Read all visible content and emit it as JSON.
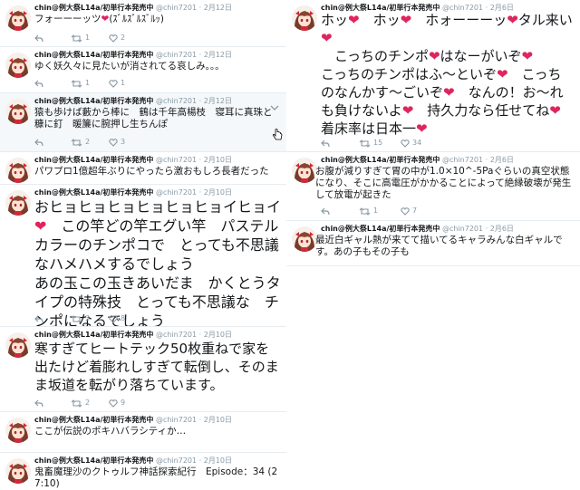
{
  "user": {
    "name": "chin@例大祭L14a/初単行本発売中",
    "handle": "@chin7201",
    "separator": "·"
  },
  "left_tweets": [
    {
      "date": "2月12日",
      "text": "フォーーーッツ❤️(ｽﾞﾙｽﾞﾙｽﾞﾙｯ)",
      "reply_count": "",
      "retweet_count": "1",
      "like_count": "2"
    },
    {
      "date": "2月12日",
      "text": "ゆく妖久々に見たいが消されてる哀しみ。。。",
      "reply_count": "",
      "retweet_count": "1",
      "like_count": "1"
    },
    {
      "date": "2月12日",
      "text": "猿も歩けば藪から棒に　鶴は千年高楊枝　寝耳に真珠と糠に釘　暖簾に腕押し生ちんぽ",
      "reply_count": "",
      "retweet_count": "2",
      "like_count": "3"
    },
    {
      "date": "2月10日",
      "text": "パワプロ1億超年ぶりにやったら激おもしろ長者だった",
      "reply_count": "",
      "retweet_count": "",
      "like_count": ""
    },
    {
      "date": "2月10日",
      "text": "おヒョヒョヒョヒョヒョヒョイヒョイ❤️　この竿どの竿エグい竿　パステルカラーのチンポコで　とっても不思議なハメハメするでしょう\nあの玉この玉きあいだま　かくとうタイプの特殊技　とっても不思議な　チンポになるでしょう",
      "reply_count": "",
      "retweet_count": "3",
      "like_count": "8"
    },
    {
      "date": "2月10日",
      "text": "寒すぎてヒートテック50枚重ねで家を出たけど着膨れしすぎて転倒し、そのまま坂道を転がり落ちています。",
      "reply_count": "",
      "retweet_count": "2",
      "like_count": "9"
    },
    {
      "date": "2月10日",
      "text": "ここが伝説のポキハバラシティか…",
      "reply_count": "",
      "retweet_count": "",
      "like_count": ""
    },
    {
      "date": "2月10日",
      "text": "鬼畜魔理沙のクトゥルフ神話探索紀行　Episode：34 (27:10)",
      "reply_count": "",
      "retweet_count": "",
      "like_count": ""
    }
  ],
  "right_tweets": [
    {
      "date": "2月6日",
      "text": "ホッ❤️　ホッ❤️　ホォーーーッ❤️タル来い❤️\n　こっちのチンポ❤️はなーがいぞ❤️\nこっちのチンポはふ～といぞ❤️　こっちのなんかす～ごいぞ❤️　なんの！お～れも負けないよ❤️　持久力なら任せてね❤️　着床率は日本一❤️",
      "reply_count": "",
      "retweet_count": "15",
      "like_count": "34"
    },
    {
      "date": "2月6日",
      "text": "お腹が減りすぎて胃の中が1.0×10^-5Paぐらいの真空状態になり、そこに高電圧がかかることによって絶縁破壊が発生して放電が起きた",
      "reply_count": "",
      "retweet_count": "1",
      "like_count": "7"
    },
    {
      "date": "2月6日",
      "text": "最近白ギャル熱が来てて描いてるキャラみんな白ギャルです。あの子もその子も",
      "reply_count": "",
      "retweet_count": "",
      "like_count": ""
    }
  ],
  "icons": {
    "reply": "reply-icon",
    "retweet": "retweet-icon",
    "like": "heart-icon",
    "cursor": "hand-cursor-icon"
  },
  "colors": {
    "text": "#14171a",
    "meta": "#8899a6",
    "heart": "#e0245e",
    "divider": "#e6ecf0",
    "hover_bg": "#f5f8fa"
  }
}
